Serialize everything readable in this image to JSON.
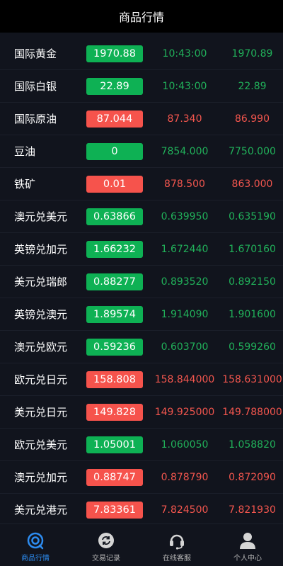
{
  "header": {
    "title": "商品行情"
  },
  "colors": {
    "up": "#0eb154",
    "down": "#f6534c",
    "active_tab": "#2d8cf0"
  },
  "rows": [
    {
      "name": "国际黄金",
      "badge": "1970.88",
      "v1": "10:43:00",
      "v2": "1970.89",
      "trend": "green"
    },
    {
      "name": "国际白银",
      "badge": "22.89",
      "v1": "10:43:00",
      "v2": "22.89",
      "trend": "green"
    },
    {
      "name": "国际原油",
      "badge": "87.044",
      "v1": "87.340",
      "v2": "86.990",
      "trend": "red"
    },
    {
      "name": "豆油",
      "badge": "0",
      "v1": "7854.000",
      "v2": "7750.000",
      "trend": "green"
    },
    {
      "name": "铁矿",
      "badge": "0.01",
      "v1": "878.500",
      "v2": "863.000",
      "trend": "red"
    },
    {
      "name": "澳元兑美元",
      "badge": "0.63866",
      "v1": "0.639950",
      "v2": "0.635190",
      "trend": "green"
    },
    {
      "name": "英镑兑加元",
      "badge": "1.66232",
      "v1": "1.672440",
      "v2": "1.670160",
      "trend": "green"
    },
    {
      "name": "美元兑瑞郎",
      "badge": "0.88277",
      "v1": "0.893520",
      "v2": "0.892150",
      "trend": "green"
    },
    {
      "name": "英镑兑澳元",
      "badge": "1.89574",
      "v1": "1.914090",
      "v2": "1.901600",
      "trend": "green"
    },
    {
      "name": "澳元兑欧元",
      "badge": "0.59236",
      "v1": "0.603700",
      "v2": "0.599260",
      "trend": "green"
    },
    {
      "name": "欧元兑日元",
      "badge": "158.808",
      "v1": "158.844000",
      "v2": "158.631000",
      "trend": "red"
    },
    {
      "name": "美元兑日元",
      "badge": "149.828",
      "v1": "149.925000",
      "v2": "149.788000",
      "trend": "red"
    },
    {
      "name": "欧元兑美元",
      "badge": "1.05001",
      "v1": "1.060050",
      "v2": "1.058820",
      "trend": "green"
    },
    {
      "name": "澳元兑加元",
      "badge": "0.88747",
      "v1": "0.878790",
      "v2": "0.872090",
      "trend": "red"
    },
    {
      "name": "美元兑港元",
      "badge": "7.83361",
      "v1": "7.824500",
      "v2": "7.821930",
      "trend": "red"
    }
  ],
  "tabs": [
    {
      "label": "商品行情",
      "icon": "market-icon",
      "active": true
    },
    {
      "label": "交易记录",
      "icon": "records-icon",
      "active": false
    },
    {
      "label": "在线客服",
      "icon": "headset-icon",
      "active": false
    },
    {
      "label": "个人中心",
      "icon": "user-icon",
      "active": false
    }
  ]
}
